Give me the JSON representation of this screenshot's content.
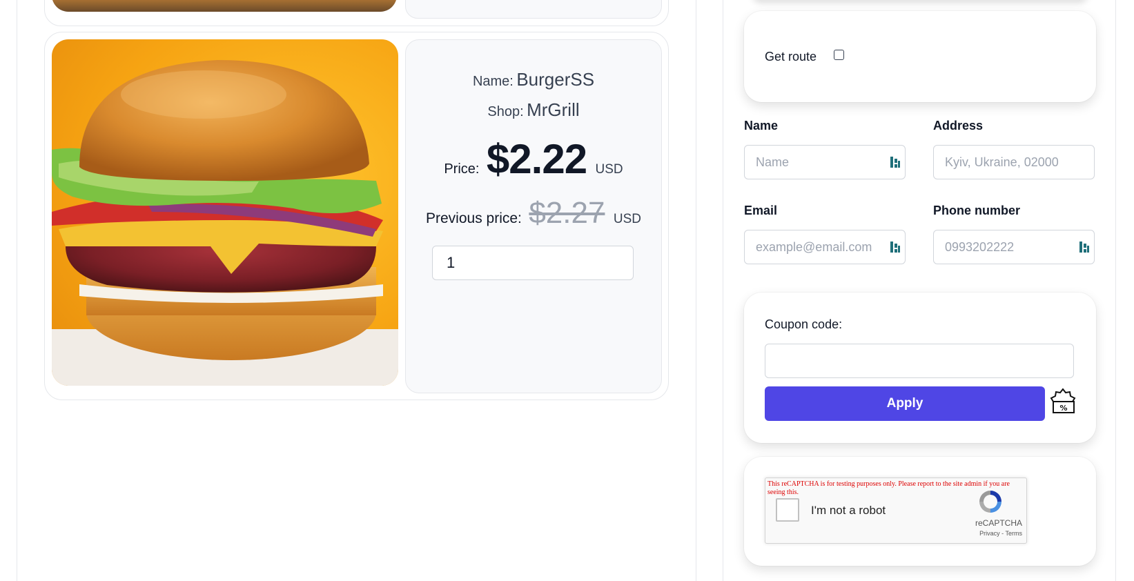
{
  "product": {
    "name_label": "Name:",
    "name": "BurgerSS",
    "shop_label": "Shop:",
    "shop": "MrGrill",
    "price_label": "Price:",
    "price": "$2.22",
    "currency": "USD",
    "previous_price_label": "Previous price:",
    "previous_price": "$2.27",
    "previous_currency": "USD",
    "quantity": "1",
    "image_icon": "burger-photo"
  },
  "route": {
    "label": "Get route",
    "checked": false
  },
  "form": {
    "name_label": "Name",
    "name_placeholder": "Name",
    "address_label": "Address",
    "address_placeholder": "Kyiv, Ukraine, 02000",
    "email_label": "Email",
    "email_placeholder": "example@email.com",
    "phone_label": "Phone number",
    "phone_placeholder": "0993202222",
    "autofill_icon": "password-manager-icon"
  },
  "coupon": {
    "label": "Coupon code:",
    "value": "",
    "apply_label": "Apply",
    "icon": "discount-coupon-icon"
  },
  "captcha": {
    "warning": "This reCAPTCHA is for testing purposes only. Please report to the site admin if you are seeing this.",
    "label": "I'm not a robot",
    "brand": "reCAPTCHA",
    "links": "Privacy - Terms"
  },
  "colors": {
    "accent": "#4f46e5",
    "card_background": "#f8f9fb",
    "border": "#e5e7eb"
  }
}
